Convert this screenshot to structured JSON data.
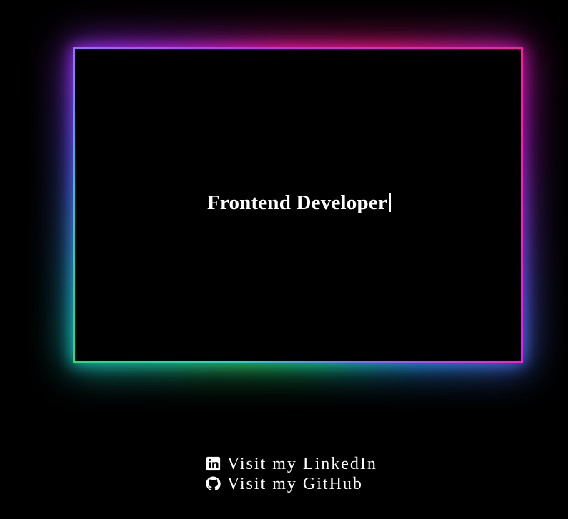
{
  "hero": {
    "typed_text": "Frontend Developer"
  },
  "links": [
    {
      "label": "Visit my LinkedIn",
      "icon": "linkedin-icon"
    },
    {
      "label": "Visit my GitHub",
      "icon": "github-icon"
    }
  ],
  "colors": {
    "background": "#000000",
    "text": "#ffffff",
    "border_green": "#1fe07a",
    "border_cyan": "#19c8e8",
    "border_purple": "#a64dff",
    "border_pink": "#ff1ac4"
  }
}
